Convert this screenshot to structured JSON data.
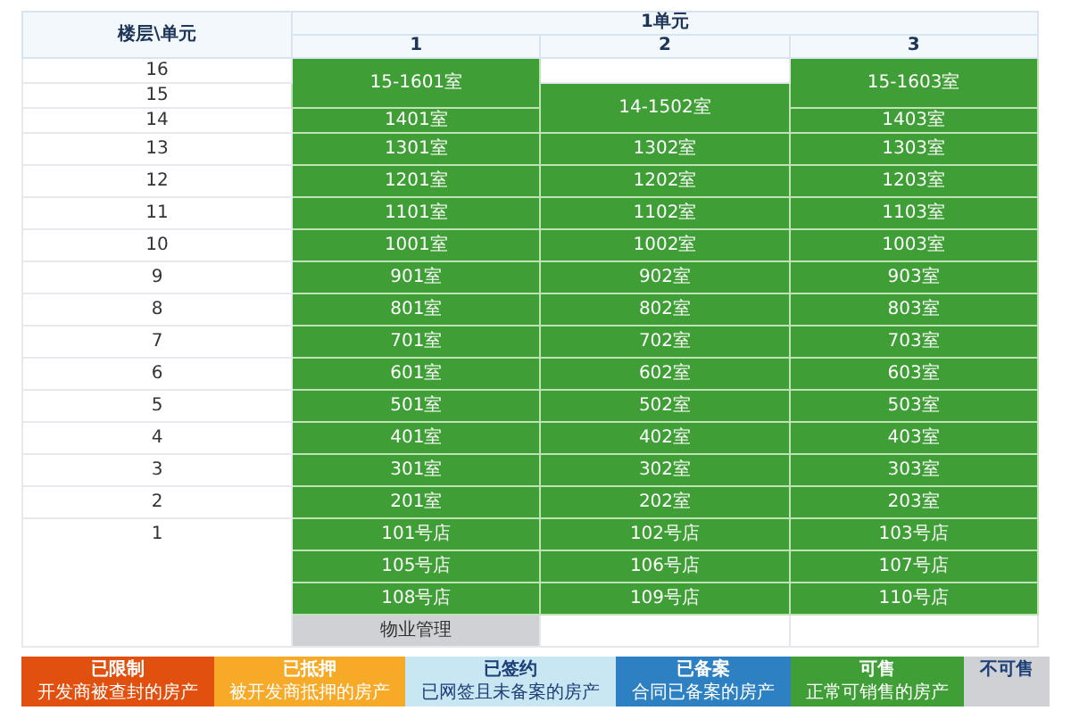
{
  "header": {
    "floor_unit": "楼层\\单元",
    "unit": "1单元",
    "columns": [
      "1",
      "2",
      "3"
    ]
  },
  "floors": [
    {
      "floor": "16",
      "cells": [
        {
          "kind": "double",
          "label": "15-1601室"
        },
        {
          "kind": "vacant"
        },
        {
          "kind": "double",
          "label": "15-1603室"
        }
      ]
    },
    {
      "floor": "15",
      "cells": [
        {
          "kind": "double",
          "label": "14-1502室"
        }
      ]
    },
    {
      "floor": "14",
      "cells": [
        {
          "kind": "room",
          "label": "1401室"
        },
        {
          "kind": "room",
          "label": "1403室"
        }
      ]
    },
    {
      "floor": "13",
      "cells": [
        {
          "kind": "room",
          "label": "1301室"
        },
        {
          "kind": "room",
          "label": "1302室"
        },
        {
          "kind": "room",
          "label": "1303室"
        }
      ]
    },
    {
      "floor": "12",
      "cells": [
        {
          "kind": "room",
          "label": "1201室"
        },
        {
          "kind": "room",
          "label": "1202室"
        },
        {
          "kind": "room",
          "label": "1203室"
        }
      ]
    },
    {
      "floor": "11",
      "cells": [
        {
          "kind": "room",
          "label": "1101室"
        },
        {
          "kind": "room",
          "label": "1102室"
        },
        {
          "kind": "room",
          "label": "1103室"
        }
      ]
    },
    {
      "floor": "10",
      "cells": [
        {
          "kind": "room",
          "label": "1001室"
        },
        {
          "kind": "room",
          "label": "1002室"
        },
        {
          "kind": "room",
          "label": "1003室"
        }
      ]
    },
    {
      "floor": "9",
      "cells": [
        {
          "kind": "room",
          "label": "901室"
        },
        {
          "kind": "room",
          "label": "902室"
        },
        {
          "kind": "room",
          "label": "903室"
        }
      ]
    },
    {
      "floor": "8",
      "cells": [
        {
          "kind": "room",
          "label": "801室"
        },
        {
          "kind": "room",
          "label": "802室"
        },
        {
          "kind": "room",
          "label": "803室"
        }
      ]
    },
    {
      "floor": "7",
      "cells": [
        {
          "kind": "room",
          "label": "701室"
        },
        {
          "kind": "room",
          "label": "702室"
        },
        {
          "kind": "room",
          "label": "703室"
        }
      ]
    },
    {
      "floor": "6",
      "cells": [
        {
          "kind": "room",
          "label": "601室"
        },
        {
          "kind": "room",
          "label": "602室"
        },
        {
          "kind": "room",
          "label": "603室"
        }
      ]
    },
    {
      "floor": "5",
      "cells": [
        {
          "kind": "room",
          "label": "501室"
        },
        {
          "kind": "room",
          "label": "502室"
        },
        {
          "kind": "room",
          "label": "503室"
        }
      ]
    },
    {
      "floor": "4",
      "cells": [
        {
          "kind": "room",
          "label": "401室"
        },
        {
          "kind": "room",
          "label": "402室"
        },
        {
          "kind": "room",
          "label": "403室"
        }
      ]
    },
    {
      "floor": "3",
      "cells": [
        {
          "kind": "room",
          "label": "301室"
        },
        {
          "kind": "room",
          "label": "302室"
        },
        {
          "kind": "room",
          "label": "303室"
        }
      ]
    },
    {
      "floor": "2",
      "cells": [
        {
          "kind": "room",
          "label": "201室"
        },
        {
          "kind": "room",
          "label": "202室"
        },
        {
          "kind": "room",
          "label": "203室"
        }
      ]
    },
    {
      "floor": "1",
      "lines": [
        [
          {
            "kind": "room",
            "label": "101号店"
          },
          {
            "kind": "room",
            "label": "102号店"
          },
          {
            "kind": "room",
            "label": "103号店"
          }
        ],
        [
          {
            "kind": "room",
            "label": "105号店"
          },
          {
            "kind": "room",
            "label": "106号店"
          },
          {
            "kind": "room",
            "label": "107号店"
          }
        ],
        [
          {
            "kind": "room",
            "label": "108号店"
          },
          {
            "kind": "room",
            "label": "109号店"
          },
          {
            "kind": "room",
            "label": "110号店"
          }
        ],
        [
          {
            "kind": "service",
            "label": "物业管理"
          },
          {
            "kind": "vacant"
          },
          {
            "kind": "vacant"
          }
        ]
      ]
    }
  ],
  "legend": [
    {
      "title": "已限制",
      "description": "开发商被查封的房产",
      "color": "#e1500e"
    },
    {
      "title": "已抵押",
      "description": "被开发商抵押的房产",
      "color": "#f7a928"
    },
    {
      "title": "已签约",
      "description": "已网签且未备案的房产",
      "color": "#c9e6f3"
    },
    {
      "title": "已备案",
      "description": "合同已备案的房产",
      "color": "#2d80c2"
    },
    {
      "title": "可售",
      "description": "正常可销售的房产",
      "color": "#3f9e36"
    },
    {
      "title": "不可售",
      "color": "#d0d1d5"
    }
  ]
}
